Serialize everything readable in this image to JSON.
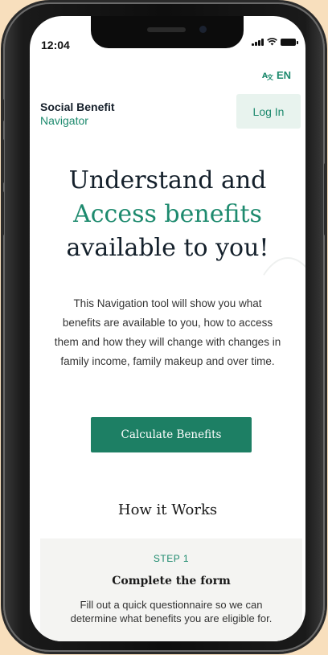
{
  "status_bar": {
    "time": "12:04"
  },
  "header": {
    "language": "EN",
    "brand_line1": "Social Benefit",
    "brand_line2": "Navigator",
    "login_label": "Log In"
  },
  "hero": {
    "title_line1": "Understand and",
    "title_line2": "Access benefits",
    "title_line3": "available to you!",
    "description": "This Navigation tool will show you what benefits are available to you, how to access them and how they will change with changes in family income, family makeup and over time.",
    "cta_label": "Calculate Benefits"
  },
  "how_it_works": {
    "heading": "How it Works",
    "steps": [
      {
        "label": "STEP 1",
        "title": "Complete the form",
        "description": "Fill out a quick questionnaire so we can determine what benefits you are eligible for."
      }
    ]
  },
  "colors": {
    "accent": "#1d8a6e",
    "button": "#1d7f64",
    "background": "#f8dfbd"
  }
}
